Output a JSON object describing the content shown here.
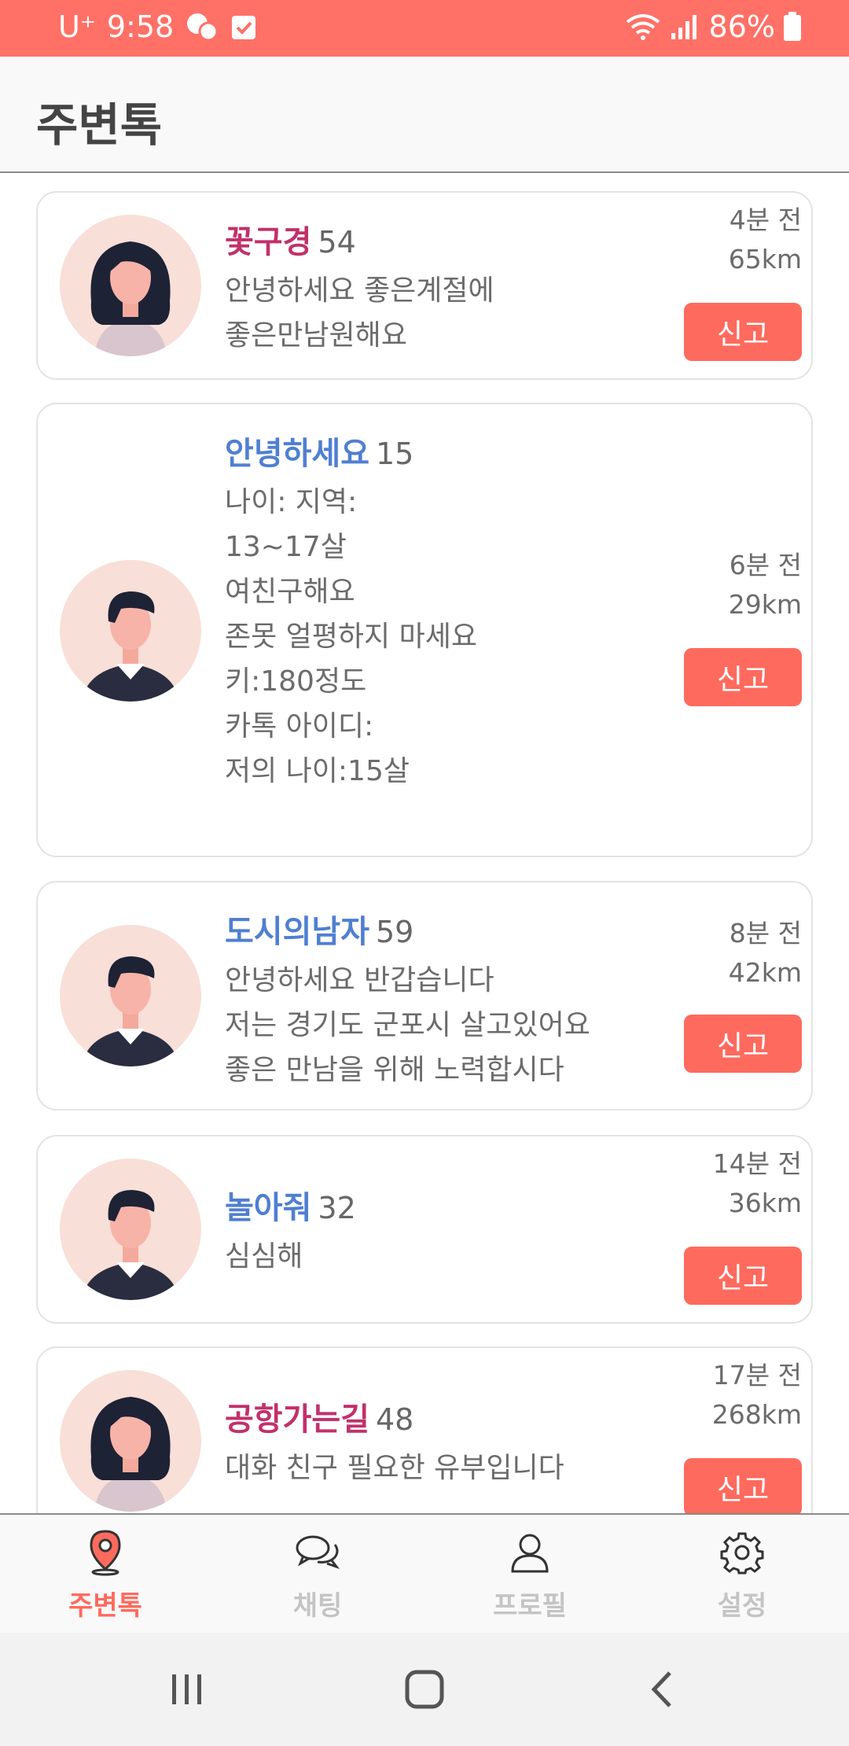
{
  "status_bar": {
    "carrier": "U⁺",
    "time": "9:58",
    "battery": "86%",
    "bg_color": "#ff7066"
  },
  "header": {
    "title": "주변톡"
  },
  "posts": [
    {
      "name": "꽃구경",
      "age": "54",
      "gender": "female",
      "lines": [
        "안녕하세요  좋은계절에",
        "좋은만남원해요"
      ],
      "time": "4분 전",
      "distance": "65km",
      "report_label": "신고"
    },
    {
      "name": "안녕하세요",
      "age": "15",
      "gender": "male",
      "lines": [
        "나이:  지역:",
        "13~17살",
        "여친구해요",
        "존못 얼평하지 마세요",
        "키:180정도",
        "카톡 아이디:",
        "저의 나이:15살"
      ],
      "time": "6분 전",
      "distance": "29km",
      "report_label": "신고"
    },
    {
      "name": "도시의남자",
      "age": "59",
      "gender": "male",
      "lines": [
        "안녕하세요 반갑습니다",
        "저는 경기도 군포시 살고있어요",
        "좋은 만남을 위해 노력합시다"
      ],
      "time": "8분 전",
      "distance": "42km",
      "report_label": "신고"
    },
    {
      "name": "놀아줘",
      "age": "32",
      "gender": "male",
      "lines": [
        "심심해"
      ],
      "time": "14분 전",
      "distance": "36km",
      "report_label": "신고"
    },
    {
      "name": "공항가는길",
      "age": "48",
      "gender": "female",
      "lines": [
        "대화 친구 필요한  유부입니다"
      ],
      "time": "17분 전",
      "distance": "268km",
      "report_label": "신고"
    }
  ],
  "bottom_nav": [
    {
      "label": "주변톡",
      "icon": "location-pin-icon",
      "active": true
    },
    {
      "label": "채팅",
      "icon": "chat-bubbles-icon",
      "active": false
    },
    {
      "label": "프로필",
      "icon": "person-icon",
      "active": false
    },
    {
      "label": "설정",
      "icon": "gear-icon",
      "active": false
    }
  ],
  "colors": {
    "accent": "#ff6a5e",
    "female_name": "#c2306b",
    "male_name": "#4f7fd1"
  }
}
